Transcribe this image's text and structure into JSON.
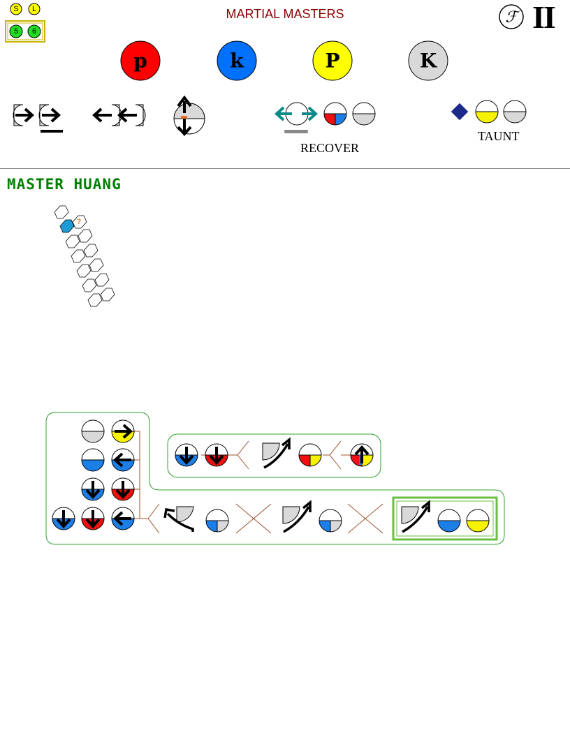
{
  "header": {
    "title": "MARTIAL MASTERS",
    "roman": "II",
    "f_glyph": "ℱ",
    "version_badges": {
      "top": [
        "S",
        "L"
      ],
      "bottom": [
        "5",
        "6"
      ]
    }
  },
  "buttons": [
    {
      "letter": "p",
      "color": "#ff0000"
    },
    {
      "letter": "k",
      "color": "#0070ff"
    },
    {
      "letter": "P",
      "color": "#ffff00"
    },
    {
      "letter": "K",
      "color": "#d9d9d9"
    }
  ],
  "legend": {
    "recover_label": "RECOVER",
    "taunt_label": "TAUNT"
  },
  "character": {
    "name": "MASTER HUANG",
    "select_marker": "?"
  },
  "colors": {
    "red": "#ee1111",
    "blue": "#1c7fe8",
    "yellow": "#f7f200",
    "gray": "#d9d9d9",
    "green_border": "#2ea02e",
    "branch": "#a0522d",
    "teal": "#0b8a8a",
    "highlight_box": "#6abf40",
    "title": "#8b0000"
  }
}
